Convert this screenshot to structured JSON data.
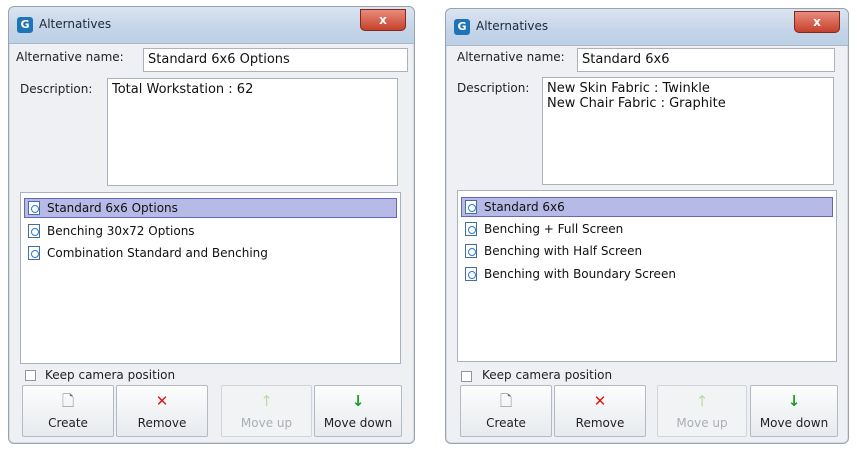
{
  "left_window": {
    "title": "Alternatives",
    "close_label": "x",
    "name_label": "Alternative name:",
    "name_value": "Standard 6x6 Options",
    "description_label": "Description:",
    "description_value": "Total Workstation : 62",
    "items": [
      {
        "label": "Standard 6x6 Options",
        "selected": true
      },
      {
        "label": "Benching 30x72 Options",
        "selected": false
      },
      {
        "label": "Combination Standard and Benching",
        "selected": false
      }
    ],
    "keep_camera_label": "Keep camera position",
    "keep_camera_checked": false,
    "buttons": {
      "create": "Create",
      "remove": "Remove",
      "move_up": "Move up",
      "move_down": "Move down"
    },
    "move_up_enabled": false
  },
  "right_window": {
    "title": "Alternatives",
    "close_label": "x",
    "name_label": "Alternative name:",
    "name_value": "Standard 6x6",
    "description_label": "Description:",
    "description_value": "New Skin Fabric : Twinkle\nNew Chair Fabric : Graphite",
    "items": [
      {
        "label": "Standard 6x6",
        "selected": true
      },
      {
        "label": "Benching + Full Screen",
        "selected": false
      },
      {
        "label": "Benching with Half Screen",
        "selected": false
      },
      {
        "label": "Benching with Boundary Screen",
        "selected": false
      }
    ],
    "keep_camera_label": "Keep camera position",
    "keep_camera_checked": false,
    "buttons": {
      "create": "Create",
      "remove": "Remove",
      "move_up": "Move up",
      "move_down": "Move down"
    },
    "move_up_enabled": false
  },
  "icons": {
    "app": "alternatives-app-icon",
    "create": "new-document-icon",
    "remove": "red-x-icon",
    "move_up": "green-up-arrow-icon",
    "move_down": "green-down-arrow-icon",
    "list_item": "alternative-document-icon"
  },
  "colors": {
    "selection": "#b7b9e6",
    "close_button": "#c5412b",
    "remove_icon": "#d81c1c",
    "arrow_icon": "#1e9b2c"
  }
}
